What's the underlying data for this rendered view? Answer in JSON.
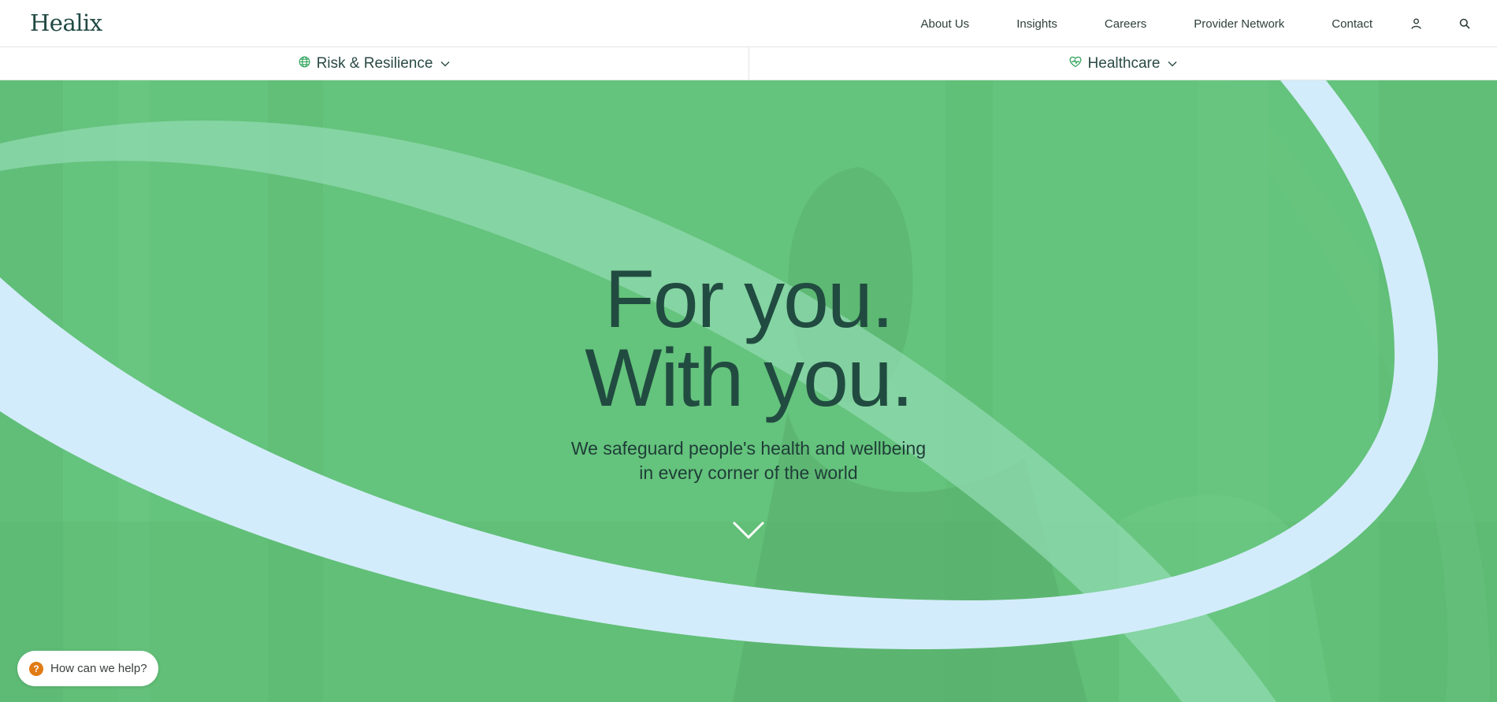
{
  "header": {
    "logo_text": "Healix",
    "nav": [
      "About Us",
      "Insights",
      "Careers",
      "Provider Network",
      "Contact"
    ],
    "icons": [
      "user-icon",
      "search-icon"
    ]
  },
  "subnav": {
    "left": {
      "label": "Risk & Resilience",
      "icon": "globe-icon"
    },
    "right": {
      "label": "Healthcare",
      "icon": "heart-pulse-icon"
    }
  },
  "hero": {
    "headline_line1": "For you.",
    "headline_line2": "With you.",
    "subheadline_line1": "We safeguard people's health and wellbeing",
    "subheadline_line2": "in every corner of the world",
    "scroll_icon": "chevron-down-icon"
  },
  "help": {
    "label": "How can we help?",
    "icon_glyph": "?"
  },
  "colors": {
    "hero_green": "#64c37c",
    "ribbon_blue": "#d3ecfb",
    "headline_dark": "#214b40",
    "accent_green": "#2fa35a",
    "help_orange": "#e07b14"
  }
}
